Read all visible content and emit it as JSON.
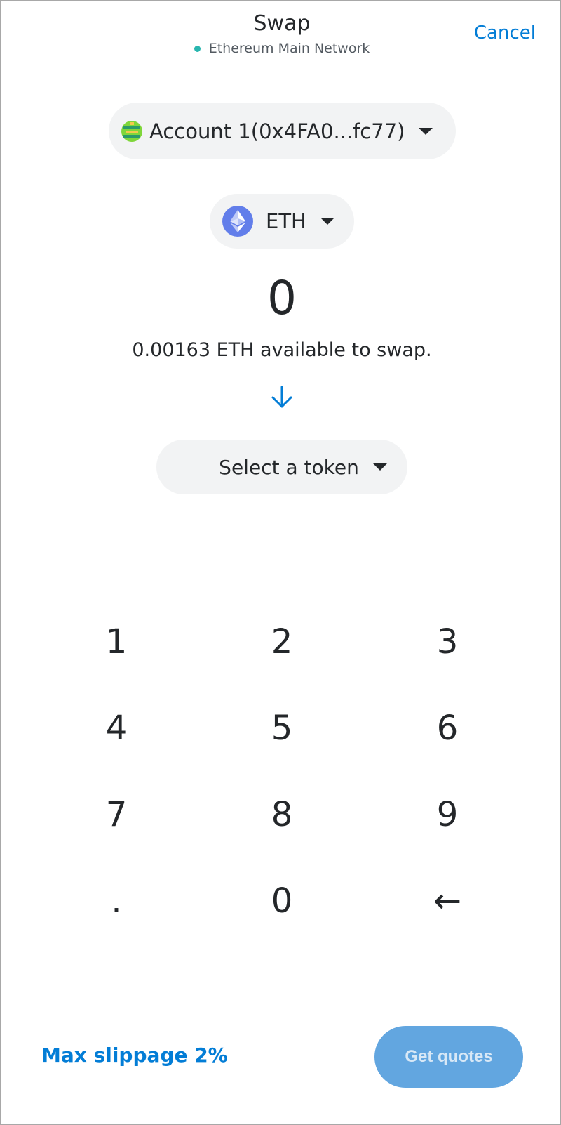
{
  "header": {
    "title": "Swap",
    "network_label": "Ethereum Main Network",
    "network_dot_color": "#29b6af",
    "cancel_label": "Cancel"
  },
  "account": {
    "label": "Account 1(0x4FA0...fc77)",
    "avatar_icon": "identicon-avatar"
  },
  "source_token": {
    "symbol": "ETH",
    "icon": "ethereum-icon",
    "amount": "0",
    "available_text": "0.00163 ETH available to swap."
  },
  "swap_direction_icon": "arrow-down-icon",
  "destination_token": {
    "placeholder": "Select a token"
  },
  "keypad": {
    "keys": [
      "1",
      "2",
      "3",
      "4",
      "5",
      "6",
      "7",
      "8",
      "9",
      ".",
      "0",
      "←"
    ]
  },
  "footer": {
    "slippage_label": "Max slippage 2%",
    "quotes_button_label": "Get quotes"
  },
  "colors": {
    "accent": "#037dd6",
    "button_disabled": "#62a6e0",
    "pill_background": "#f2f3f4"
  }
}
